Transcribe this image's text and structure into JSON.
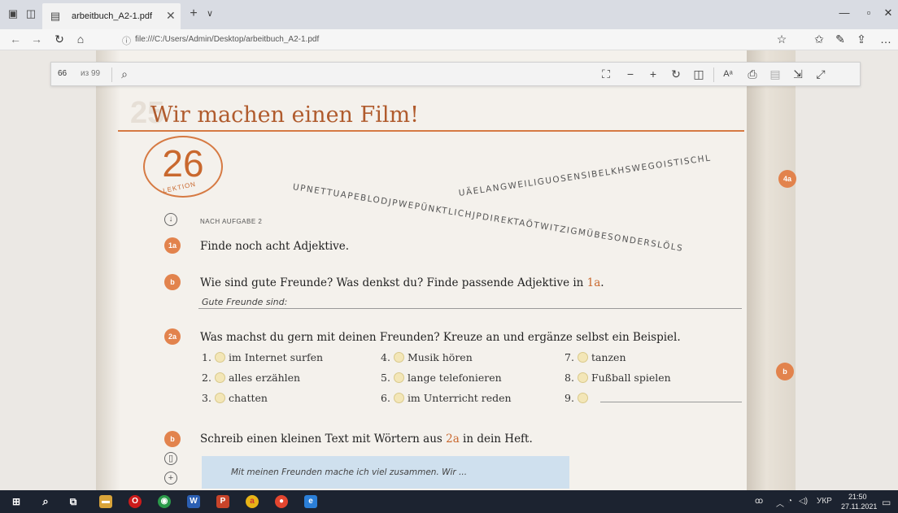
{
  "browser": {
    "tab_title": "arbeitbuch_A2-1.pdf",
    "url": "file:///C:/Users/Admin/Desktop/arbeitbuch_A2-1.pdf"
  },
  "pdf_toolbar": {
    "page_current": "66",
    "page_total": "из 99"
  },
  "workbook": {
    "title": "Wir machen einen Film!",
    "lesson_number": "26",
    "lesson_label": "LEKTION",
    "word_snake": {
      "line1": "UPNETTUAPEBLODJPWEPÜNKTLICHJPDIREKTAÖTWITZIGMÜBESONDERSLÖLS",
      "line2": "UÄELANGWEILIGUOSENSIBELKHSWEGOISTISCHL"
    },
    "nach_aufgabe": "NACH AUFGABE 2",
    "tasks": {
      "t1a": {
        "badge": "1a",
        "text": "Finde noch acht Adjektive."
      },
      "t1b": {
        "badge": "b",
        "text": "Wie sind gute Freunde? Was denkst du? Finde passende Adjektive in ",
        "ref": "1a",
        "after": "."
      },
      "t1b_answer": "Gute Freunde sind:",
      "t2a": {
        "badge": "2a",
        "text": "Was machst du gern mit deinen Freunden? Kreuze an und ergänze selbst ein Beispiel."
      },
      "t2b": {
        "badge": "b",
        "text": "Schreib einen kleinen Text mit Wörtern aus ",
        "ref": "2a",
        "after": " in dein Heft."
      }
    },
    "options": [
      {
        "num": "1.",
        "text": "im Internet surfen"
      },
      {
        "num": "2.",
        "text": "alles erzählen"
      },
      {
        "num": "3.",
        "text": "chatten"
      },
      {
        "num": "4.",
        "text": "Musik hören"
      },
      {
        "num": "5.",
        "text": "lange telefonieren"
      },
      {
        "num": "6.",
        "text": "im Unterricht reden"
      },
      {
        "num": "7.",
        "text": "tanzen"
      },
      {
        "num": "8.",
        "text": "Fußball spielen"
      },
      {
        "num": "9.",
        "text": ""
      }
    ],
    "example_text": "Mit meinen Freunden mache ich viel zusammen. Wir ...",
    "side_badges": {
      "top": "4a",
      "bottom": "b"
    },
    "ghost_number": "25"
  },
  "taskbar": {
    "lang": "УКР",
    "time": "21:50",
    "date": "27.11.2021"
  },
  "colors": {
    "accent_orange": "#e2834d",
    "title_orange": "#b05b2d",
    "answer_circle": "#f3e6b7",
    "example_box": "#cfe0ee"
  }
}
